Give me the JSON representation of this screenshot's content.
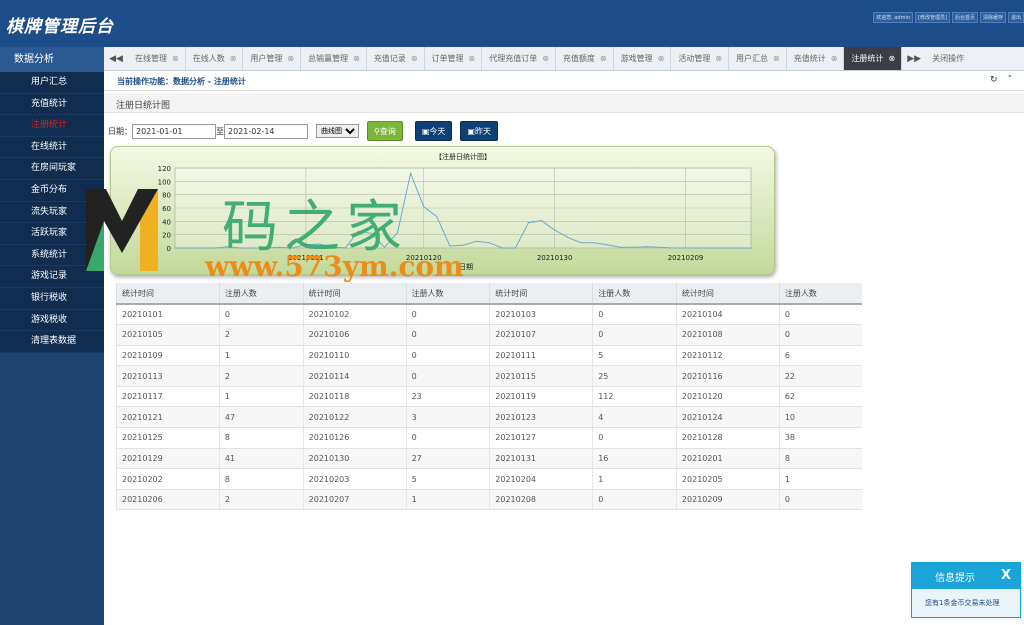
{
  "app": {
    "title": "棋牌管理后台"
  },
  "topbar": {
    "items": [
      "欢迎您, admin",
      "[修改管理员]",
      "后台首页",
      "清除缓存",
      "退出"
    ]
  },
  "sidebar": {
    "title": "数据分析",
    "items": [
      "用户汇总",
      "充值统计",
      "注册统计",
      "在线统计",
      "在房间玩家",
      "金币分布",
      "流失玩家",
      "活跃玩家",
      "系统统计",
      "游戏记录",
      "银行税收",
      "游戏税收",
      "清理表数据"
    ],
    "active_index": 2
  },
  "tabs": {
    "prev": "◀◀",
    "next": "▶▶",
    "items": [
      "在线管理",
      "在线人数",
      "用户管理",
      "总输赢管理",
      "充值记录",
      "订单管理",
      "代理充值订单",
      "充值额度",
      "游戏管理",
      "活动管理",
      "用户汇总",
      "充值统计",
      "注册统计"
    ],
    "active_index": 12,
    "close_label": "关闭操作"
  },
  "breadcrumb": "当前操作功能：数据分析 - 注册统计",
  "subtitle": "注册日统计图",
  "filter": {
    "date_label": "日期：",
    "start": "2021-01-01",
    "to": "至",
    "end": "2021-02-14",
    "chart_type": "曲线图",
    "query_btn": "查询",
    "today_btn": "今天",
    "yesterday_btn": "昨天"
  },
  "chart_data": {
    "type": "line",
    "title": "【注册日统计图】",
    "xlabel": "日期",
    "x": [
      "20210101",
      "20210102",
      "20210103",
      "20210104",
      "20210105",
      "20210106",
      "20210107",
      "20210108",
      "20210109",
      "20210110",
      "20210111",
      "20210112",
      "20210113",
      "20210114",
      "20210115",
      "20210116",
      "20210117",
      "20210118",
      "20210119",
      "20210120",
      "20210121",
      "20210122",
      "20210123",
      "20210124",
      "20210125",
      "20210126",
      "20210127",
      "20210128",
      "20210129",
      "20210130",
      "20210131",
      "20210201",
      "20210202",
      "20210203",
      "20210204",
      "20210205",
      "20210206",
      "20210207",
      "20210208",
      "20210209",
      "20210210",
      "20210211",
      "20210212",
      "20210213",
      "20210214"
    ],
    "values": [
      0,
      0,
      0,
      0,
      2,
      0,
      0,
      0,
      1,
      0,
      5,
      6,
      2,
      0,
      25,
      22,
      1,
      23,
      112,
      62,
      47,
      3,
      4,
      10,
      8,
      0,
      0,
      38,
      41,
      27,
      16,
      8,
      8,
      5,
      1,
      1,
      2,
      1,
      0,
      0,
      0,
      0,
      0,
      0,
      0
    ],
    "x_ticks": [
      "20210111",
      "20210120",
      "20210130",
      "20210209"
    ],
    "ylim": [
      0,
      120
    ],
    "y_ticks": [
      0,
      20,
      40,
      60,
      80,
      100,
      120
    ],
    "grid": true,
    "line_color": "#6aa8d8"
  },
  "table": {
    "headers": [
      "统计时间",
      "注册人数",
      "统计时间",
      "注册人数",
      "统计时间",
      "注册人数",
      "统计时间",
      "注册人数"
    ],
    "rows": [
      [
        "20210101",
        "0",
        "20210102",
        "0",
        "20210103",
        "0",
        "20210104",
        "0"
      ],
      [
        "20210105",
        "2",
        "20210106",
        "0",
        "20210107",
        "0",
        "20210108",
        "0"
      ],
      [
        "20210109",
        "1",
        "20210110",
        "0",
        "20210111",
        "5",
        "20210112",
        "6"
      ],
      [
        "20210113",
        "2",
        "20210114",
        "0",
        "20210115",
        "25",
        "20210116",
        "22"
      ],
      [
        "20210117",
        "1",
        "20210118",
        "23",
        "20210119",
        "112",
        "20210120",
        "62"
      ],
      [
        "20210121",
        "47",
        "20210122",
        "3",
        "20210123",
        "4",
        "20210124",
        "10"
      ],
      [
        "20210125",
        "8",
        "20210126",
        "0",
        "20210127",
        "0",
        "20210128",
        "38"
      ],
      [
        "20210129",
        "41",
        "20210130",
        "27",
        "20210131",
        "16",
        "20210201",
        "8"
      ],
      [
        "20210202",
        "8",
        "20210203",
        "5",
        "20210204",
        "1",
        "20210205",
        "1"
      ],
      [
        "20210206",
        "2",
        "20210207",
        "1",
        "20210208",
        "0",
        "20210209",
        "0"
      ]
    ]
  },
  "watermark": {
    "cn": "码之家",
    "url": "www.573ym.com"
  },
  "notice": {
    "title": "信息提示",
    "close": "X",
    "message": "您有1条金币交易未处理"
  }
}
